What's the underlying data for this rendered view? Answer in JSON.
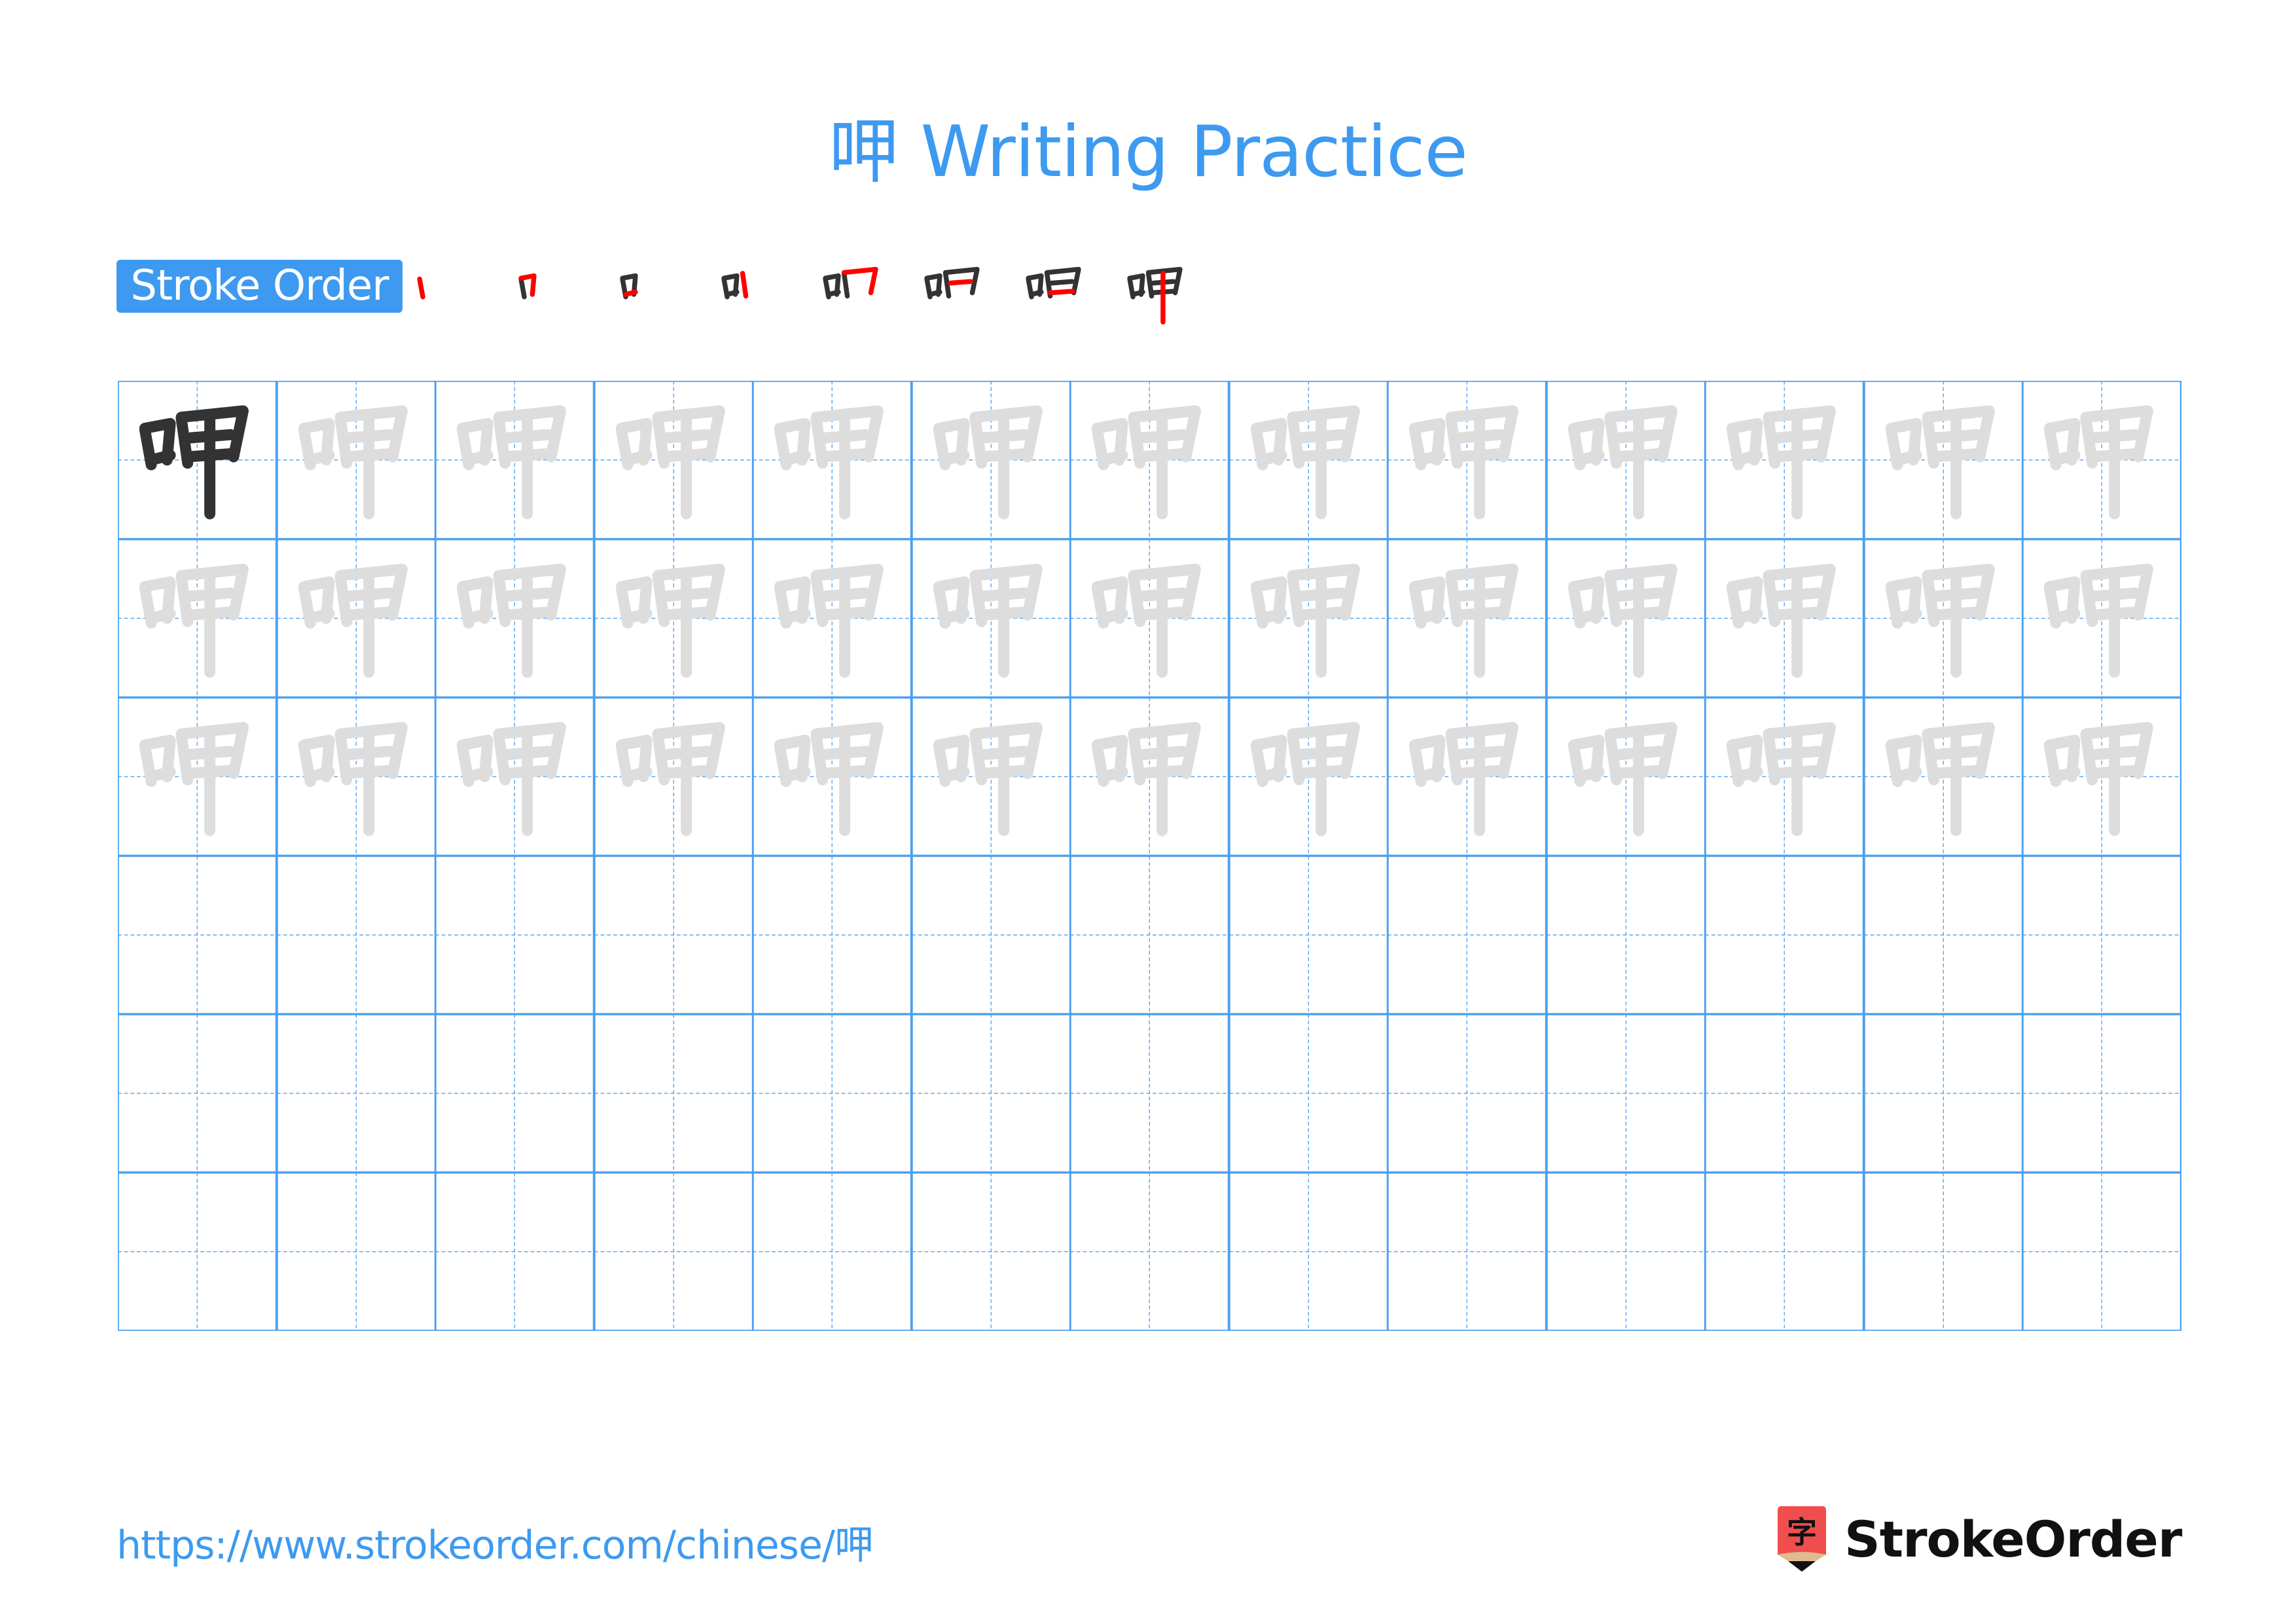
{
  "page": {
    "title_char": "呷",
    "title_text": "Writing Practice",
    "stroke_order_label": "Stroke Order",
    "stroke_count": 8,
    "footer_url": "https://www.strokeorder.com/chinese/呷",
    "logo_char": "字",
    "logo_text": "StrokeOrder"
  },
  "colors": {
    "accent": "#3d9af0",
    "grid_line": "#4a9ff0",
    "guide_dash": "#5aa8f2",
    "ink": "#333333",
    "trace": "#dddddd",
    "highlight": "#ff0000",
    "logo_red": "#f04e4e",
    "logo_tan": "#dfbb90"
  },
  "grid": {
    "columns": 13,
    "rows": 6,
    "model_cells": 1,
    "trace_rows": 3,
    "empty_rows": 3
  }
}
